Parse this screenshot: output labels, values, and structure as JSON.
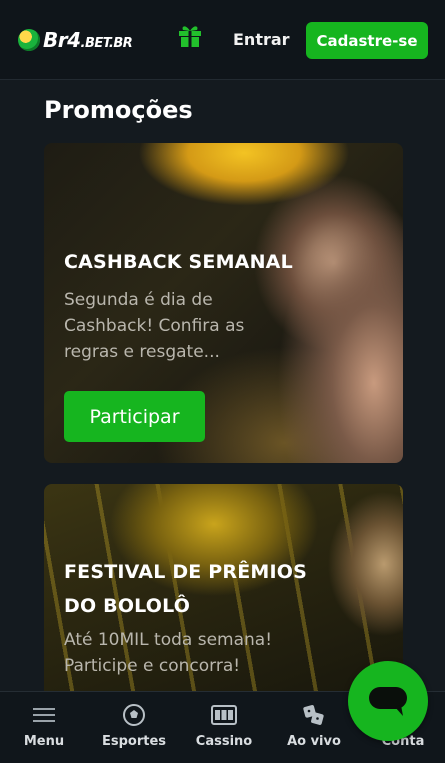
{
  "header": {
    "logo_main": "Br4",
    "logo_suffix": ".BET.BR",
    "gift_icon": "gift-icon",
    "login_label": "Entrar",
    "signup_label": "Cadastre-se",
    "accent_color": "#16b51f"
  },
  "page": {
    "title": "Promoções"
  },
  "promos": [
    {
      "title": "CASHBACK SEMANAL",
      "description": "Segunda é dia de Cashback! Confira as regras e resgate...",
      "button_label": "Participar"
    },
    {
      "title": "FESTIVAL DE PRÊMIOS DO BOLOLÔ",
      "description": "Até 10MIL toda semana! Participe e concorra!"
    }
  ],
  "bottom_nav": {
    "items": [
      {
        "label": "Menu",
        "icon": "hamburger-icon"
      },
      {
        "label": "Esportes",
        "icon": "soccer-ball-icon"
      },
      {
        "label": "Cassino",
        "icon": "slot-machine-icon"
      },
      {
        "label": "Ao vivo",
        "icon": "dice-icon"
      },
      {
        "label": "Conta",
        "icon": "user-icon"
      }
    ]
  },
  "chat": {
    "icon": "chat-bubble-icon"
  }
}
